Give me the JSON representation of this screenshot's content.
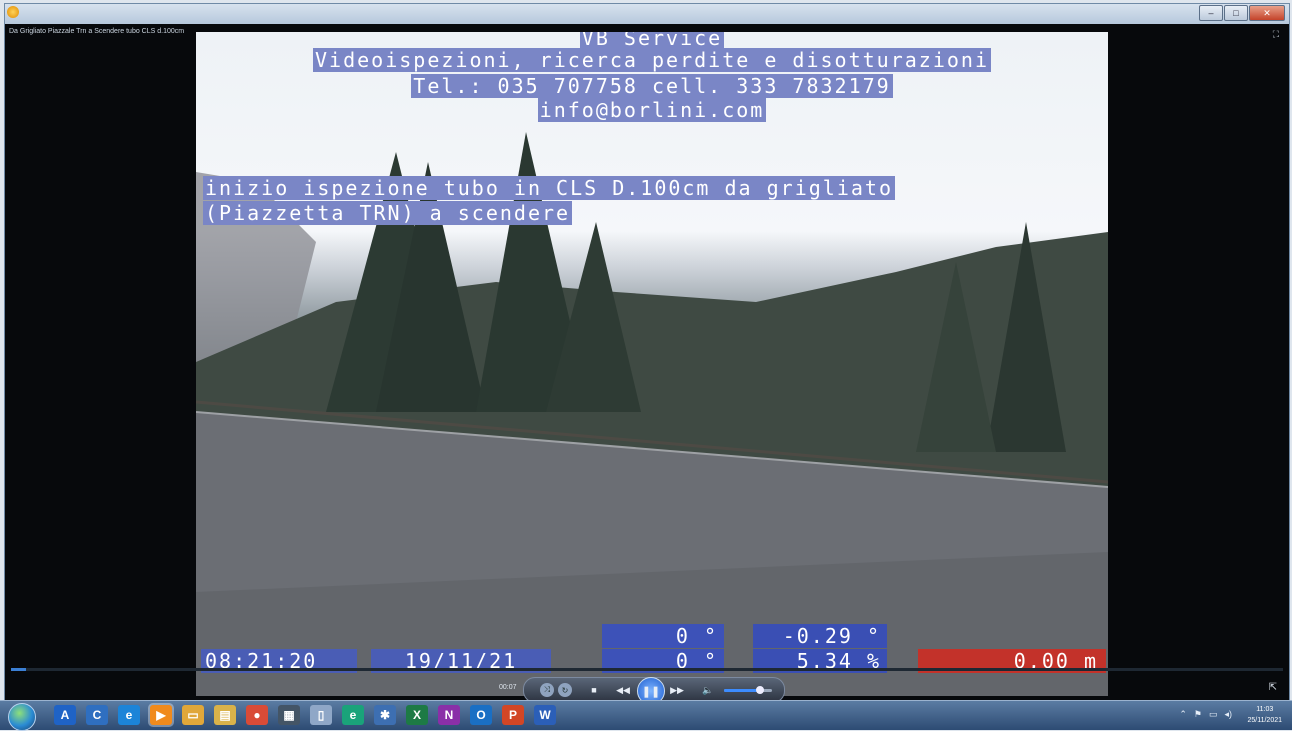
{
  "window": {
    "title": "Da Grigliato Piazzale Trn a Scendere tubo CLS d.100cm",
    "controls": {
      "minimize": "–",
      "maximize": "□",
      "close": "✕"
    }
  },
  "video": {
    "header_lines": [
      "VB Service",
      "Videoispezioni, ricerca perdite e disotturazioni",
      "Tel.: 035 707758 cell. 333 7832179",
      "info@borlini.com"
    ],
    "caption_lines": [
      "inizio ispezione tubo in CLS D.100cm da grigliato ",
      "(Piazzetta TRN) a scendere"
    ],
    "time": "08:21:20",
    "date": "19/11/21",
    "angle_top": "0 °",
    "angle_bottom": "0 °",
    "inclination": "-0.29 °",
    "slope": "5.34 %",
    "distance": "0,00 m"
  },
  "player": {
    "elapsed": "00:07",
    "seek_progress": 0.012,
    "volume_level": 0.75,
    "icons": {
      "shuffle": "shuffle-icon",
      "repeat": "repeat-icon",
      "stop": "stop-icon",
      "previous": "previous-icon",
      "play_pause": "pause-icon",
      "next": "next-icon",
      "volume": "volume-icon",
      "fullscreen": "fullscreen-toggle-icon",
      "mini_mode": "switch-to-library-icon"
    },
    "accent_color": "#3b7fd4"
  },
  "taskbar": {
    "pinned": [
      {
        "name": "acrobat",
        "glyph": "A",
        "color": "#1f63c6"
      },
      {
        "name": "app-c",
        "glyph": "C",
        "color": "#2f6fc0"
      },
      {
        "name": "internet-explorer",
        "glyph": "e",
        "color": "#1c84d8"
      },
      {
        "name": "media-player",
        "glyph": "▶",
        "color": "#f08a1c"
      },
      {
        "name": "file-explorer",
        "glyph": "▭",
        "color": "#e0a73a"
      },
      {
        "name": "notes",
        "glyph": "▤",
        "color": "#d9b24a"
      },
      {
        "name": "chrome",
        "glyph": "●",
        "color": "#d94b37"
      },
      {
        "name": "video-editor",
        "glyph": "▦",
        "color": "#445566"
      },
      {
        "name": "document",
        "glyph": "▯",
        "color": "#8fa7c7"
      },
      {
        "name": "edge",
        "glyph": "e",
        "color": "#1aa37a"
      },
      {
        "name": "settings",
        "glyph": "✱",
        "color": "#3d6fb2"
      },
      {
        "name": "excel",
        "glyph": "X",
        "color": "#1d7a45"
      },
      {
        "name": "onenote",
        "glyph": "N",
        "color": "#8a2fa8"
      },
      {
        "name": "outlook",
        "glyph": "O",
        "color": "#1a6fc4"
      },
      {
        "name": "powerpoint",
        "glyph": "P",
        "color": "#d24625"
      },
      {
        "name": "word",
        "glyph": "W",
        "color": "#2b5fb8"
      }
    ],
    "clock_time": "11:03",
    "clock_date": "25/11/2021"
  }
}
